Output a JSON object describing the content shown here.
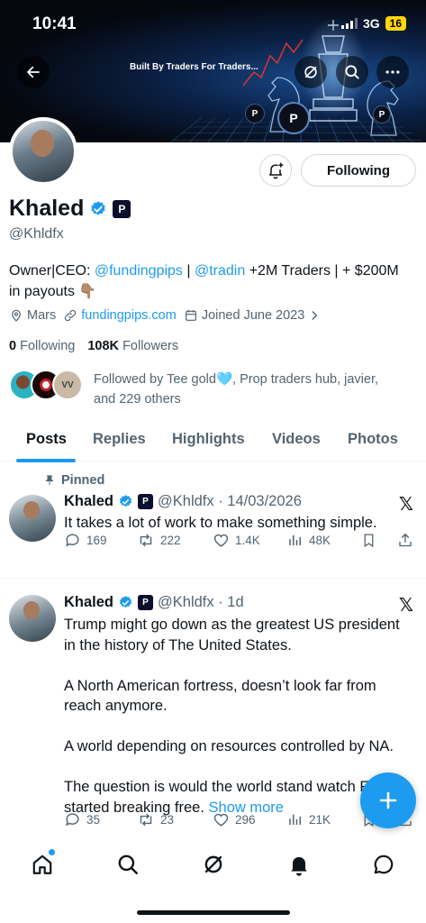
{
  "status_bar": {
    "time": "10:41",
    "network": "3G",
    "battery": "16"
  },
  "banner": {
    "tagline": "Built By Traders For Traders..."
  },
  "profile": {
    "name": "Khaled",
    "handle": "@Khldfx",
    "follow_button": "Following",
    "bio_prefix": "Owner|CEO: ",
    "bio_link1": "@fundingpips",
    "bio_sep": " | ",
    "bio_link2": "@tradin",
    "bio_suffix": " +2M Traders | + $200M in payouts 👇🏽",
    "location": "Mars",
    "website": "fundingpips.com",
    "joined": "Joined June 2023",
    "following_count": "0",
    "following_label": "Following",
    "followers_count": "108K",
    "followers_label": "Followers",
    "followed_by": "Followed by Tee gold🩵, Prop traders hub, javier, and 229 others"
  },
  "tabs": [
    "Posts",
    "Replies",
    "Highlights",
    "Videos",
    "Photos"
  ],
  "posts": [
    {
      "pinned_label": "Pinned",
      "name": "Khaled",
      "meta": "@Khldfx · 14/03/2026",
      "text": "It takes a lot of work to make something simple.",
      "replies": "169",
      "reposts": "222",
      "likes": "1.4K",
      "views": "48K"
    },
    {
      "name": "Khaled",
      "meta": "@Khldfx · 1d",
      "para1": "Trump might go down as the greatest US president in the history of The United States.",
      "para2": "A North American fortress, doesn’t look far from reach anymore.",
      "para3": "A world depending on resources controlled by NA.",
      "para4": "The question is would the world stand watch France started breaking free.",
      "show_more": "Show more",
      "replies": "35",
      "reposts": "23",
      "likes": "296",
      "views": "21K"
    }
  ],
  "colors": {
    "accent": "#1d9bf0",
    "text": "#0f1419",
    "muted": "#536471"
  }
}
